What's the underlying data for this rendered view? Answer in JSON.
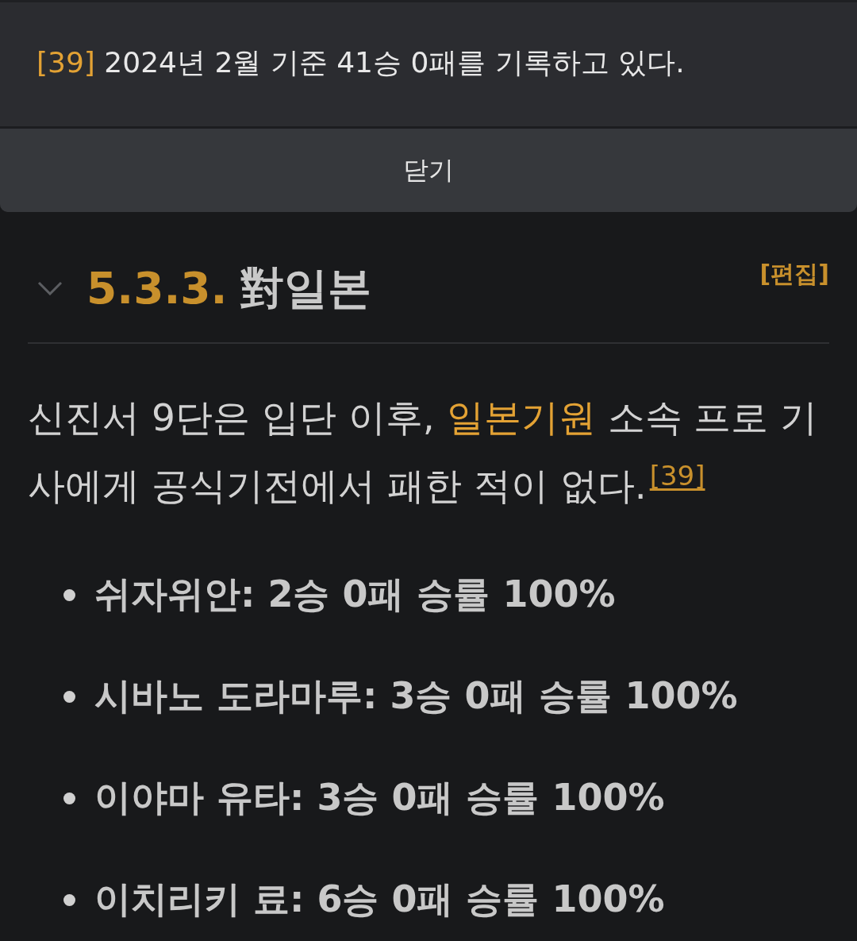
{
  "footnote_popup": {
    "ref": "[39]",
    "text": "2024년 2월 기준 41승 0패를 기록하고 있다.",
    "close_button": "닫기"
  },
  "section": {
    "expanded": true,
    "number": "5.3.3.",
    "title": "對일본",
    "edit_link": "[편집]"
  },
  "paragraph": [
    {
      "kind": "text",
      "text": "신진서 9단은 입단 이후, "
    },
    {
      "kind": "link",
      "text": "일본기원"
    },
    {
      "kind": "text",
      "text": " 소속 프로 기사에게 공식기전에서 패한 적이 없다."
    },
    {
      "kind": "footnote",
      "text": "[39]"
    }
  ],
  "records": [
    "쉬자위안: 2승 0패 승률 100%",
    "시바노 도라마루: 3승 0패 승률 100%",
    "이야마 유타: 3승 0패 승률 100%",
    "이치리키 료: 6승 0패 승률 100%"
  ]
}
